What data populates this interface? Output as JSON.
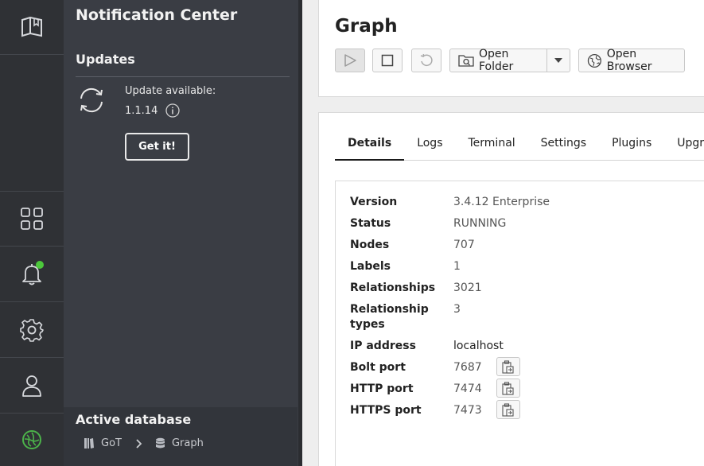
{
  "notification_center": {
    "title": "Notification Center",
    "updates_heading": "Updates",
    "update_text": "Update available:",
    "update_version": "1.1.14",
    "get_it_label": "Get it!",
    "has_unread_dot": true
  },
  "active_database": {
    "heading": "Active database",
    "project": "GoT",
    "database": "Graph"
  },
  "header": {
    "title": "Graph",
    "open_folder_label": "Open Folder",
    "open_browser_label": "Open Browser"
  },
  "tabs": [
    "Details",
    "Logs",
    "Terminal",
    "Settings",
    "Plugins",
    "Upgrade"
  ],
  "active_tab": "Details",
  "details": {
    "version": {
      "label": "Version",
      "value": "3.4.12 Enterprise"
    },
    "status": {
      "label": "Status",
      "value": "RUNNING"
    },
    "nodes": {
      "label": "Nodes",
      "value": "707"
    },
    "labels": {
      "label": "Labels",
      "value": "1"
    },
    "relationships": {
      "label": "Relationships",
      "value": "3021"
    },
    "relationship_types": {
      "label": "Relationship types",
      "value": "3"
    },
    "ip_address": {
      "label": "IP address",
      "value": "localhost"
    },
    "bolt_port": {
      "label": "Bolt port",
      "value": "7687"
    },
    "http_port": {
      "label": "HTTP port",
      "value": "7474"
    },
    "https_port": {
      "label": "HTTPS port",
      "value": "7473"
    }
  },
  "colors": {
    "rail_bg": "#2f3135",
    "panel_bg": "#3a3d44",
    "notification_dot": "#4cc83b",
    "neo4j_logo": "#4cb34a"
  }
}
